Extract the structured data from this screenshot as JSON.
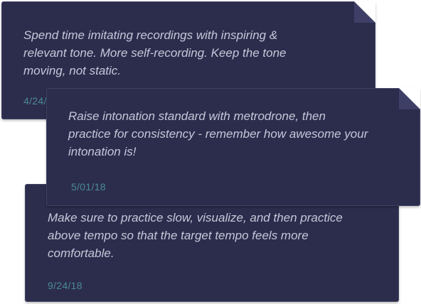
{
  "notes": [
    {
      "text": "Spend time imitating recordings with inspiring &\nrelevant tone. More self-recording. Keep the tone\nmoving, not static.",
      "date": "4/24/18"
    },
    {
      "text": "Raise intonation standard with  metrodrone, then\npractice for consistency - remember how awesome your\nintonation is!",
      "date": "5/01/18"
    },
    {
      "text": "Make sure to practice slow, visualize, and then practice\nabove tempo so that the target tempo feels more\ncomfortable.",
      "date": "9/24/18"
    }
  ],
  "colors": {
    "note_background": "#2c2d4d",
    "text": "#c6c7d8",
    "date": "#4a8a94"
  }
}
